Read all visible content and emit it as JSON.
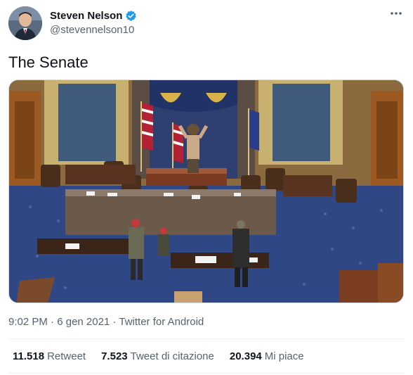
{
  "author": {
    "display_name": "Steven Nelson",
    "handle": "@stevennelson10",
    "verified": true
  },
  "tweet": {
    "text": "The Senate"
  },
  "media": {
    "type": "photo",
    "subject": "icon-photo"
  },
  "meta": {
    "time": "9:02 PM",
    "separator": "·",
    "date": "6 gen 2021",
    "source": "Twitter for Android"
  },
  "stats": {
    "retweets_count": "11.518",
    "retweets_label": "Retweet",
    "quotes_count": "7.523",
    "quotes_label": "Tweet di citazione",
    "likes_count": "20.394",
    "likes_label": "Mi piace"
  },
  "colors": {
    "verified": "#1d9bf0",
    "secondary_text": "#536471",
    "primary_text": "#0f1419"
  }
}
